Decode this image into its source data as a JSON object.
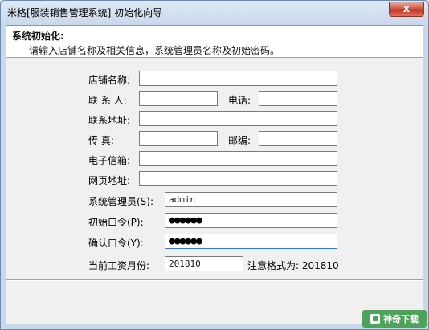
{
  "window": {
    "title": "米格[服装销售管理系统] 初始化向导",
    "close_label": "x"
  },
  "header": {
    "title": "系统初始化:",
    "description": "请输入店铺名称及相关信息，系统管理员名称及初始密码。"
  },
  "form": {
    "store_name_label": "店铺名称:",
    "store_name_value": "",
    "contact_label": "联 系 人:",
    "contact_value": "",
    "phone_label": "电话:",
    "phone_value": "",
    "address_label": "联系地址:",
    "address_value": "",
    "fax_label": "传    真:",
    "fax_value": "",
    "postcode_label": "邮编:",
    "postcode_value": "",
    "email_label": "电子信箱:",
    "email_value": "",
    "website_label": "网页地址:",
    "website_value": "",
    "admin_label": "系统管理员(S):",
    "admin_value": "admin",
    "init_password_label": "初始口令(P):",
    "init_password_value": "●●●●●●",
    "confirm_password_label": "确认口令(Y):",
    "confirm_password_value": "●●●●●●",
    "salary_month_label": "当前工资月份:",
    "salary_month_value": "201810",
    "format_note": "注意格式为: 201810"
  },
  "watermark": {
    "text": "神奇下载"
  }
}
